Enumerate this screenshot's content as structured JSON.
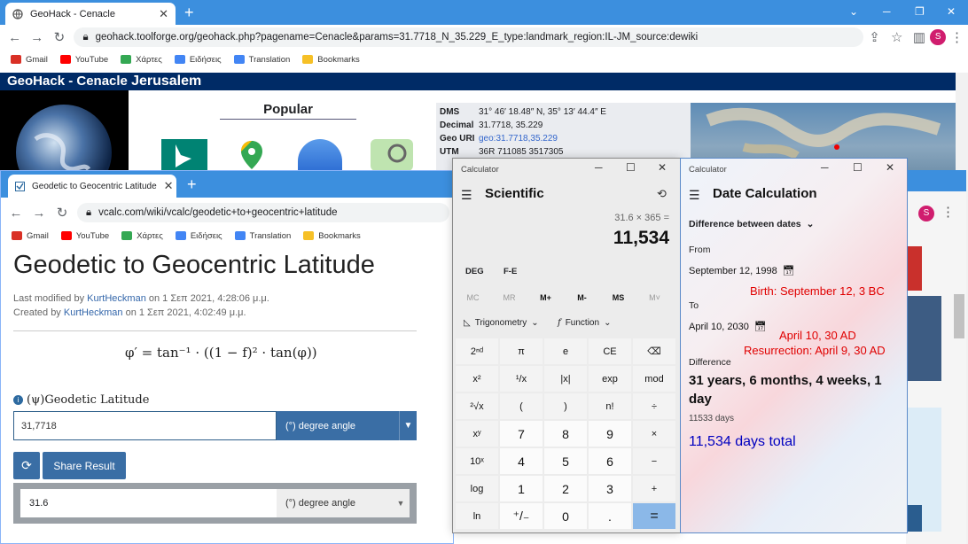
{
  "w1": {
    "tab_title": "GeoHack - Cenacle",
    "url": "geohack.toolforge.org/geohack.php?pagename=Cenacle&params=31.7718_N_35.229_E_type:landmark_region:IL-JM_source:dewiki",
    "avatar": "S"
  },
  "bookmarks": [
    {
      "label": "Gmail",
      "color": "#d93025"
    },
    {
      "label": "YouTube",
      "color": "#ff0000"
    },
    {
      "label": "Χάρτες",
      "color": "#34a853"
    },
    {
      "label": "Ειδήσεις",
      "color": "#4285f4"
    },
    {
      "label": "Translation",
      "color": "#4285f4"
    },
    {
      "label": "Bookmarks",
      "color": "#f6c026"
    }
  ],
  "geohack": {
    "header": "GeoHack - Cenacle",
    "header_place": "Jerusalem",
    "popular": "Popular",
    "rows": [
      {
        "k": "DMS",
        "v": "31° 46′ 18.48″ N, 35° 13′ 44.4″ E"
      },
      {
        "k": "Decimal",
        "v": "31.7718, 35.229"
      },
      {
        "k": "Geo URI",
        "v": "geo:31.7718,35.229"
      },
      {
        "k": "UTM",
        "v": "36R 711085 3517305"
      }
    ]
  },
  "w2": {
    "tab_title": "Geodetic to Geocentric Latitude",
    "url": "vcalc.com/wiki/vcalc/geodetic+to+geocentric+latitude",
    "avatar": "S",
    "page_title": "Geodetic to Geocentric Latitude",
    "modified_prefix": "Last modified by",
    "modified_user": "KurtHeckman",
    "modified_date": "on 1 Σεπ 2021, 4:28:06 μ.μ.",
    "created_prefix": "Created by",
    "created_user": "KurtHeckman",
    "created_date": "on 1 Σεπ 2021, 4:02:49 μ.μ.",
    "formula": "φ′ = tan⁻¹ · ((1 − f)² · tan(φ))",
    "input_label": "(ψ)Geodetic Latitude",
    "input_value": "31,7718",
    "input_unit": "(°) degree angle",
    "share_label": "Share Result",
    "result_value": "31.6",
    "result_unit": "(°) degree angle"
  },
  "calc1": {
    "window_title": "Calculator",
    "mode": "Scientific",
    "expression": "31.6 × 365 =",
    "display": "11,534",
    "deg": "DEG",
    "fe": "F-E",
    "memory": [
      "MC",
      "MR",
      "M+",
      "M-",
      "MS",
      "M˅"
    ],
    "trig": "Trigonometry",
    "function": "Function",
    "keys": [
      [
        "2ⁿᵈ",
        "π",
        "e",
        "CE",
        "⌫"
      ],
      [
        "x²",
        "¹/x",
        "|x|",
        "exp",
        "mod"
      ],
      [
        "²√x",
        "(",
        ")",
        "n!",
        "÷"
      ],
      [
        "xʸ",
        "7",
        "8",
        "9",
        "×"
      ],
      [
        "10ˣ",
        "4",
        "5",
        "6",
        "−"
      ],
      [
        "log",
        "1",
        "2",
        "3",
        "+"
      ],
      [
        "ln",
        "⁺/₋",
        "0",
        ".",
        "="
      ]
    ]
  },
  "calc2": {
    "window_title": "Calculator",
    "mode": "Date Calculation",
    "dropdown": "Difference between dates",
    "from_label": "From",
    "from_date": "September 12, 1998",
    "to_label": "To",
    "to_date": "April 10, 2030",
    "difference_label": "Difference",
    "difference": "31 years, 6 months, 4 weeks, 1 day",
    "days": "11533 days",
    "ann_birth": "Birth: September 12, 3 BC",
    "ann_april": "April 10, 30 AD",
    "ann_resurrection": "Resurrection: April 9, 30 AD",
    "ann_total": "11,534 days total"
  }
}
